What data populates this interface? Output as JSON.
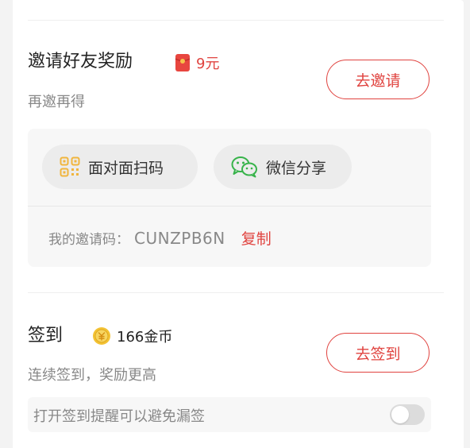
{
  "invite": {
    "title": "邀请好友奖励",
    "reward": "9元",
    "reward_icon": "red-envelope-icon",
    "subtitle": "再邀再得",
    "button_label": "去邀请",
    "share_options": [
      {
        "label": "面对面扫码",
        "icon": "qr-code-icon"
      },
      {
        "label": "微信分享",
        "icon": "wechat-icon"
      }
    ],
    "code_label": "我的邀请码：",
    "code_value": "CUNZPB6N",
    "copy_label": "复制"
  },
  "checkin": {
    "title": "签到",
    "reward": "166金币",
    "reward_icon": "gold-coin-icon",
    "subtitle": "连续签到，奖励更高",
    "button_label": "去签到",
    "reminder_text": "打开签到提醒可以避免漏签",
    "reminder_enabled": false
  },
  "colors": {
    "accent": "#e0433f",
    "qr_icon": "#f1b53d",
    "wechat_icon": "#37b34a",
    "coin": "#f3c233"
  }
}
